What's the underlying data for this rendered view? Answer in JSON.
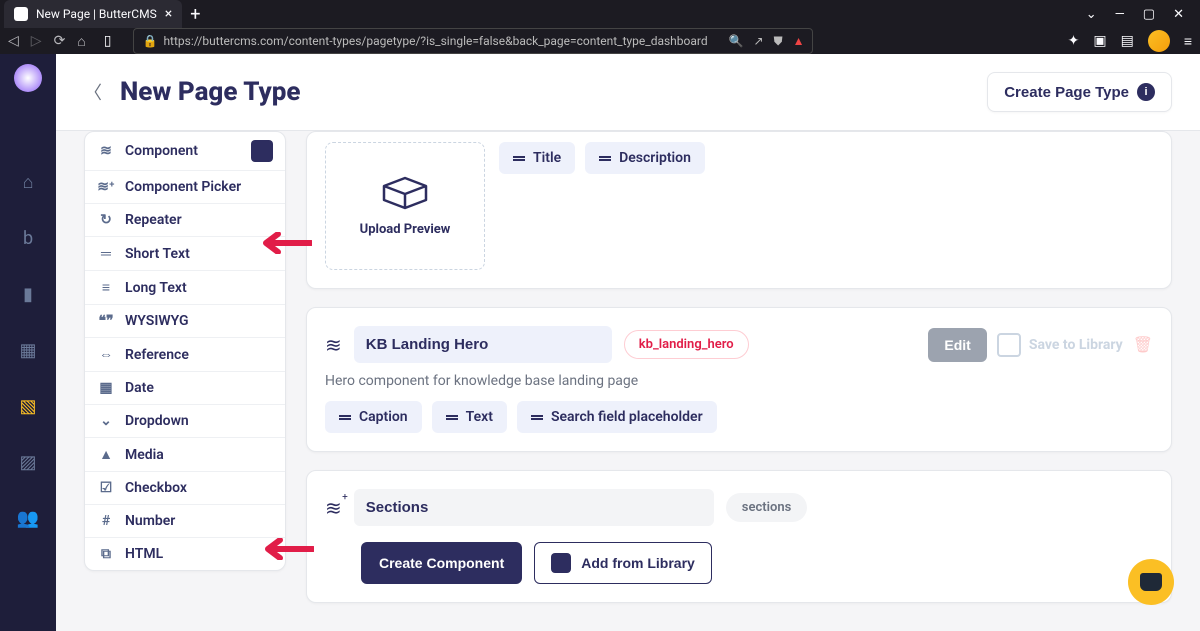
{
  "browser": {
    "tab_title": "New Page | ButterCMS",
    "url": "https://buttercms.com/content-types/pagetype/?is_single=false&back_page=content_type_dashboard"
  },
  "header": {
    "title": "New Page Type",
    "create_button": "Create Page Type"
  },
  "fields": [
    {
      "icon": "layers",
      "label": "Component",
      "extra": true
    },
    {
      "icon": "layers-plus",
      "label": "Component Picker"
    },
    {
      "icon": "repeat",
      "label": "Repeater"
    },
    {
      "icon": "short",
      "label": "Short Text"
    },
    {
      "icon": "long",
      "label": "Long Text"
    },
    {
      "icon": "quotes",
      "label": "WYSIWYG"
    },
    {
      "icon": "link",
      "label": "Reference"
    },
    {
      "icon": "calendar",
      "label": "Date"
    },
    {
      "icon": "chevdown",
      "label": "Dropdown"
    },
    {
      "icon": "image",
      "label": "Media"
    },
    {
      "icon": "check",
      "label": "Checkbox"
    },
    {
      "icon": "hash",
      "label": "Number"
    },
    {
      "icon": "code",
      "label": "HTML"
    }
  ],
  "first_panel": {
    "upload_label": "Upload Preview",
    "chips": [
      "Title",
      "Description"
    ]
  },
  "component_panel": {
    "name": "KB Landing Hero",
    "slug": "kb_landing_hero",
    "description": "Hero component for knowledge base landing page",
    "edit_label": "Edit",
    "save_label": "Save to Library",
    "fields": [
      "Caption",
      "Text",
      "Search field placeholder"
    ]
  },
  "sections_panel": {
    "name": "Sections",
    "slug": "sections",
    "create_label": "Create Component",
    "add_label": "Add from Library"
  }
}
